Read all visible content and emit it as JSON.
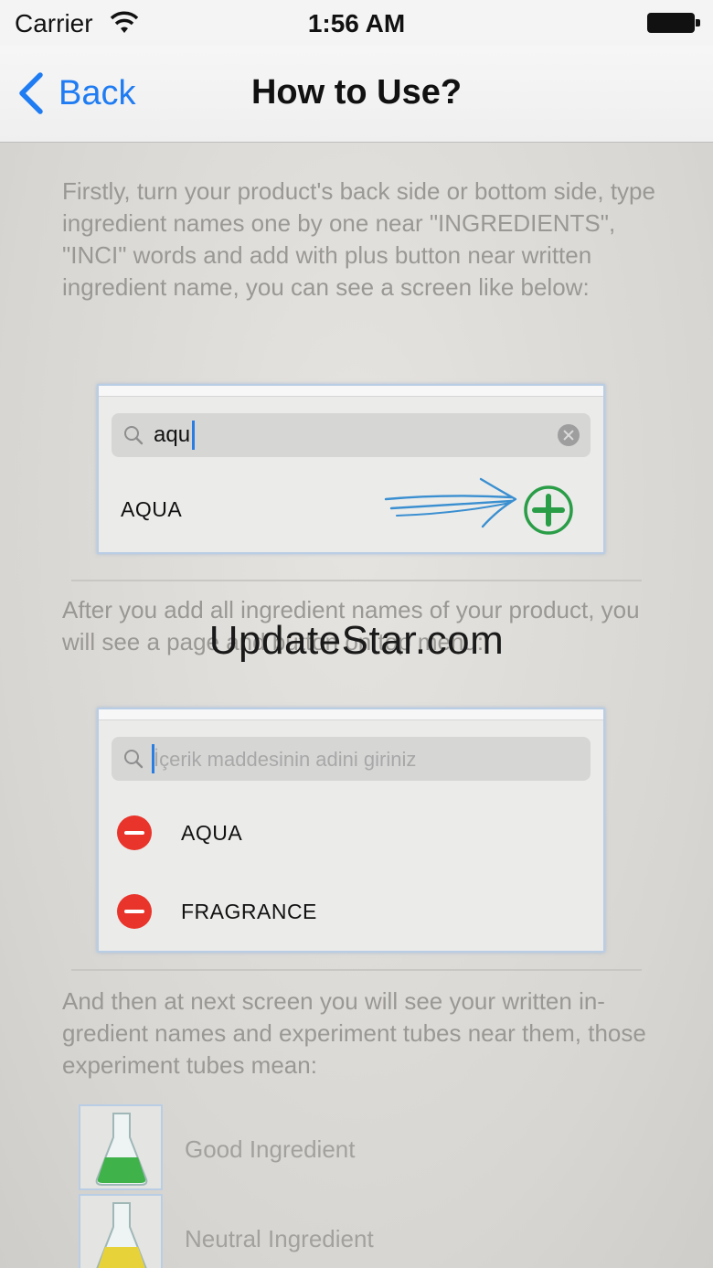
{
  "status_bar": {
    "carrier": "Carrier",
    "time": "1:56 AM"
  },
  "nav": {
    "back_label": "Back",
    "title": "How to Use?"
  },
  "steps": [
    "Firstly, turn your product's back side or bottom side, type ingredient names one by one near \"INGREDIENTS\", \"INCI\" words and add with plus button near written ingredient name, you can see a screen like below:",
    "After you add all ingredient names of your product, you will see a page and button on top menu:",
    "And then at next screen you will see your written in-gredient names and experiment tubes near them, those experiment tubes mean:"
  ],
  "demo_search": {
    "query": "aqu",
    "result": "AQUA"
  },
  "demo_list": {
    "placeholder": "İçerik maddesinin adini giriniz",
    "items": [
      "AQUA",
      "FRAGRANCE"
    ]
  },
  "legend": [
    {
      "label": "Good Ingredient",
      "color": "#3fb24a"
    },
    {
      "label": "Neutral Ingredient",
      "color": "#e8d23a"
    }
  ],
  "watermark": "UpdateStar.com",
  "colors": {
    "accent": "#1f7cf2",
    "add": "#2a9d47",
    "remove": "#e8342a"
  }
}
